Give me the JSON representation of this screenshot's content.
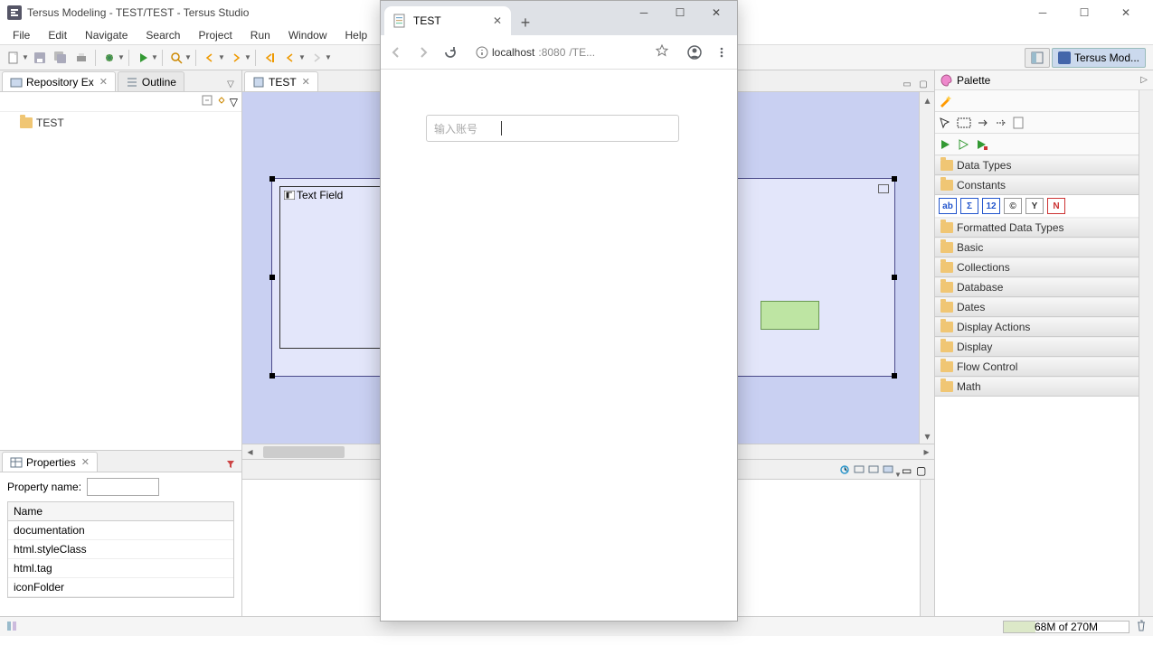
{
  "window": {
    "title": "Tersus Modeling - TEST/TEST - Tersus Studio"
  },
  "menu": [
    "File",
    "Edit",
    "Navigate",
    "Search",
    "Project",
    "Run",
    "Window",
    "Help"
  ],
  "perspective": {
    "label": "Tersus Mod..."
  },
  "leftViews": {
    "repo": {
      "label": "Repository Ex"
    },
    "outline": {
      "label": "Outline"
    },
    "treeItem": "TEST"
  },
  "editor": {
    "tabLabel": "TEST",
    "textFieldLabel": "Text Field"
  },
  "properties": {
    "tabLabel": "Properties",
    "filterLabel": "Property name:",
    "header": "Name",
    "rows": [
      "documentation",
      "html.styleClass",
      "html.tag",
      "iconFolder"
    ]
  },
  "palette": {
    "title": "Palette",
    "cats": [
      "Data Types",
      "Constants",
      "Formatted Data Types",
      "Basic",
      "Collections",
      "Database",
      "Dates",
      "Display Actions",
      "Display",
      "Flow Control",
      "Math"
    ],
    "chips": [
      "ab",
      "Σ",
      "12",
      "©",
      "Y",
      "N"
    ]
  },
  "statusbar": {
    "heap": "68M of 270M"
  },
  "browser": {
    "tabTitle": "TEST",
    "urlHost": "localhost",
    "urlPort": ":8080",
    "urlPath": "/TE...",
    "placeholder": "输入账号"
  }
}
